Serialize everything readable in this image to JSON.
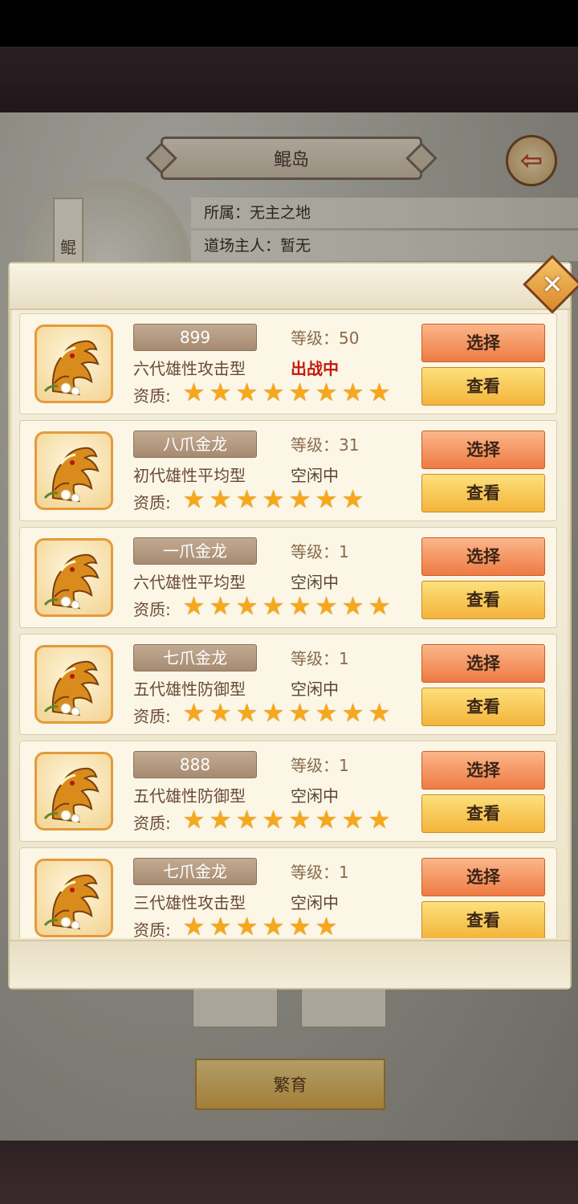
{
  "background": {
    "title": "鲲岛",
    "island_banner": "鲲",
    "info_owner_label": "所属：无主之地",
    "info_master_label": "道场主人：暂无",
    "breed_button": "繁育"
  },
  "labels": {
    "level_prefix": "等级：",
    "quality_label": "资质:",
    "select_button": "选择",
    "view_button": "查看"
  },
  "icons": {
    "back": "back-arrow-icon",
    "close": "close-icon",
    "star": "star-icon",
    "avatar": "golden-dragon-icon"
  },
  "colors": {
    "select_button": "#ee7b43",
    "view_button": "#f3b43a",
    "active_status": "#c21a0e",
    "star": "#f6a81a"
  },
  "dragons": [
    {
      "name": "899",
      "level": "等级：50",
      "type": "六代雄性攻击型",
      "status": "出战中",
      "active": true,
      "stars": 8
    },
    {
      "name": "八爪金龙",
      "level": "等级：31",
      "type": "初代雄性平均型",
      "status": "空闲中",
      "active": false,
      "stars": 7
    },
    {
      "name": "一爪金龙",
      "level": "等级：1",
      "type": "六代雄性平均型",
      "status": "空闲中",
      "active": false,
      "stars": 8
    },
    {
      "name": "七爪金龙",
      "level": "等级：1",
      "type": "五代雄性防御型",
      "status": "空闲中",
      "active": false,
      "stars": 8
    },
    {
      "name": "888",
      "level": "等级：1",
      "type": "五代雄性防御型",
      "status": "空闲中",
      "active": false,
      "stars": 8
    },
    {
      "name": "七爪金龙",
      "level": "等级：1",
      "type": "三代雄性攻击型",
      "status": "空闲中",
      "active": false,
      "stars": 6
    }
  ]
}
